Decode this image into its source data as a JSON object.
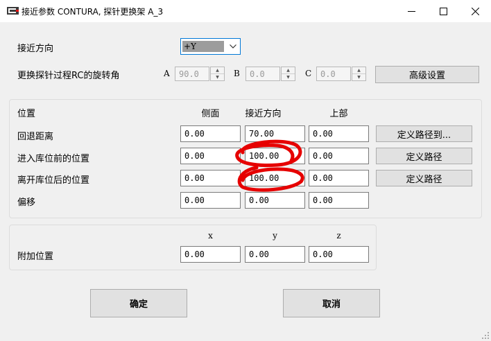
{
  "window": {
    "title": "接近参数 CONTURA, 探针更换架 A_3",
    "controls": {
      "minimize": "—",
      "maximize": "☐",
      "close": "✕"
    }
  },
  "approach": {
    "label": "接近方向",
    "select_value": "+Y"
  },
  "rotation": {
    "label": "更换探针过程RC的旋转角",
    "a_label": "A",
    "a_value": "90.0",
    "b_label": "B",
    "b_value": "0.0",
    "c_label": "C",
    "c_value": "0.0",
    "advanced_button": "高级设置"
  },
  "position_group": {
    "header": "位置",
    "col_side": "侧面",
    "col_approach": "接近方向",
    "col_top": "上部",
    "rows": [
      {
        "label": "回退距离",
        "side": "0.00",
        "approach": "70.00",
        "top": "0.00",
        "button": "定义路径到..."
      },
      {
        "label": "进入库位前的位置",
        "side": "0.00",
        "approach": "100.00",
        "top": "0.00",
        "button": "定义路径"
      },
      {
        "label": "离开库位后的位置",
        "side": "0.00",
        "approach": "100.00",
        "top": "0.00",
        "button": "定义路径"
      },
      {
        "label": "偏移",
        "side": "0.00",
        "approach": "0.00",
        "top": "0.00"
      }
    ]
  },
  "extra_group": {
    "label": "附加位置",
    "col_x": "x",
    "col_y": "y",
    "col_z": "z",
    "x": "0.00",
    "y": "0.00",
    "z": "0.00"
  },
  "footer": {
    "ok": "确定",
    "cancel": "取消"
  },
  "colors": {
    "annotation": "#e60000",
    "select_highlight": "#9c9c9c"
  }
}
